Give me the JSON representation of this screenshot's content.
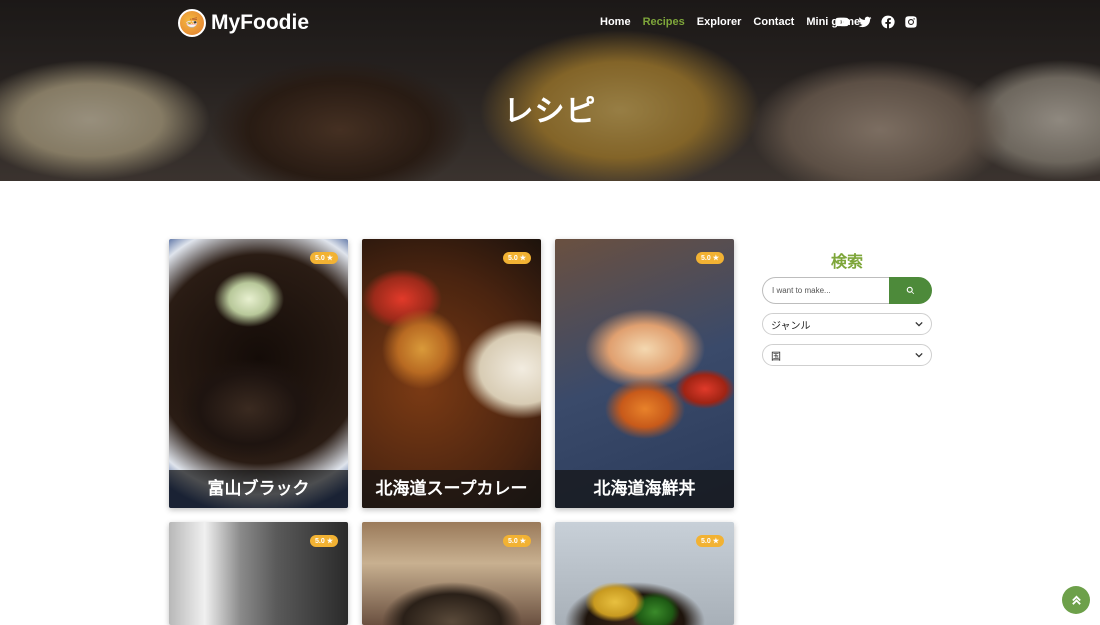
{
  "nav": {
    "brand": "MyFoodie",
    "menu": [
      {
        "label": "Home",
        "active": false
      },
      {
        "label": "Recipes",
        "active": true
      },
      {
        "label": "Explorer",
        "active": false
      },
      {
        "label": "Contact",
        "active": false
      },
      {
        "label": "Mini game",
        "active": false
      }
    ],
    "socials": [
      "youtube-icon",
      "twitter-icon",
      "facebook-icon",
      "instagram-icon"
    ]
  },
  "hero": {
    "title": "レシピ"
  },
  "recipes": [
    {
      "name": "富山ブラック",
      "rating": "5.0"
    },
    {
      "name": "北海道スープカレー",
      "rating": "5.0"
    },
    {
      "name": "北海道海鮮丼",
      "rating": "5.0"
    },
    {
      "name": "",
      "rating": "5.0"
    },
    {
      "name": "",
      "rating": "5.0"
    },
    {
      "name": "",
      "rating": "5.0"
    }
  ],
  "sidebar": {
    "title": "検索",
    "search_placeholder": "I want to make...",
    "genre_label": "ジャンル",
    "country_label": "国"
  },
  "colors": {
    "accent": "#7ea63a",
    "button": "#4d8a3a",
    "rating_badge": "#f2b233"
  }
}
